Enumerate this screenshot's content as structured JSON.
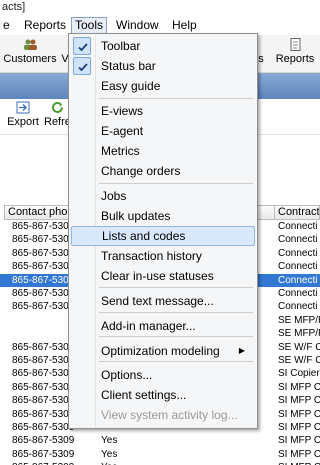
{
  "window": {
    "title_fragment": "acts]"
  },
  "menubar": {
    "items": [
      "e",
      "Reports",
      "Tools",
      "Window",
      "Help"
    ]
  },
  "toolbar": {
    "customers_label": "Customers",
    "cut_label": "V",
    "s_label": "s",
    "reports_label": "Reports",
    "export_label": "Export",
    "refresh_label": "Refre"
  },
  "tools_menu": {
    "items": [
      {
        "label": "Toolbar",
        "checked": true,
        "disabled": false,
        "submenu": false,
        "highlighted": false
      },
      {
        "label": "Status bar",
        "checked": true,
        "disabled": false,
        "submenu": false,
        "highlighted": false
      },
      {
        "label": "Easy guide",
        "checked": false,
        "disabled": false,
        "submenu": false,
        "highlighted": false
      },
      {
        "label": "E-views",
        "checked": false,
        "disabled": false,
        "submenu": false,
        "highlighted": false
      },
      {
        "label": "E-agent",
        "checked": false,
        "disabled": false,
        "submenu": false,
        "highlighted": false
      },
      {
        "label": "Metrics",
        "checked": false,
        "disabled": false,
        "submenu": false,
        "highlighted": false
      },
      {
        "label": "Change orders",
        "checked": false,
        "disabled": false,
        "submenu": false,
        "highlighted": false
      },
      {
        "label": "Jobs",
        "checked": false,
        "disabled": false,
        "submenu": false,
        "highlighted": false
      },
      {
        "label": "Bulk updates",
        "checked": false,
        "disabled": false,
        "submenu": false,
        "highlighted": false
      },
      {
        "label": "Lists and codes",
        "checked": false,
        "disabled": false,
        "submenu": false,
        "highlighted": true
      },
      {
        "label": "Transaction history",
        "checked": false,
        "disabled": false,
        "submenu": false,
        "highlighted": false
      },
      {
        "label": "Clear in-use statuses",
        "checked": false,
        "disabled": false,
        "submenu": false,
        "highlighted": false
      },
      {
        "label": "Send text message...",
        "checked": false,
        "disabled": false,
        "submenu": false,
        "highlighted": false
      },
      {
        "label": "Add-in manager...",
        "checked": false,
        "disabled": false,
        "submenu": false,
        "highlighted": false
      },
      {
        "label": "Optimization modeling",
        "checked": false,
        "disabled": false,
        "submenu": true,
        "highlighted": false
      },
      {
        "label": "Options...",
        "checked": false,
        "disabled": false,
        "submenu": false,
        "highlighted": false
      },
      {
        "label": "Client settings...",
        "checked": false,
        "disabled": false,
        "submenu": false,
        "highlighted": false
      },
      {
        "label": "View system activity log...",
        "checked": false,
        "disabled": true,
        "submenu": false,
        "highlighted": false
      }
    ]
  },
  "grid": {
    "columns": [
      "Contact phone",
      "Contract"
    ],
    "rows": [
      {
        "phone": "865-867-5309",
        "mid": "",
        "contract": "Connecti"
      },
      {
        "phone": "865-867-5309",
        "mid": "",
        "contract": "Connecti"
      },
      {
        "phone": "865-867-5309",
        "mid": "",
        "contract": "Connecti"
      },
      {
        "phone": "865-867-5309",
        "mid": "",
        "contract": "Connecti"
      },
      {
        "phone": "865-867-5309",
        "mid": "",
        "contract": "Connecti"
      },
      {
        "phone": "865-867-5309",
        "mid": "",
        "contract": "Connecti"
      },
      {
        "phone": "865-867-5309",
        "mid": "",
        "contract": "Connecti"
      },
      {
        "phone": "",
        "mid": "",
        "contract": "SE MFP/R"
      },
      {
        "phone": "",
        "mid": "",
        "contract": "SE MFP/R"
      },
      {
        "phone": "865-867-5309",
        "mid": "",
        "contract": "SE W/F C"
      },
      {
        "phone": "865-867-5309",
        "mid": "",
        "contract": "SE W/F C"
      },
      {
        "phone": "865-867-5309",
        "mid": "",
        "contract": "SI Copier"
      },
      {
        "phone": "865-867-5309",
        "mid": "",
        "contract": "SI MFP C"
      },
      {
        "phone": "865-867-5309",
        "mid": "",
        "contract": "SI MFP C"
      },
      {
        "phone": "865-867-5309",
        "mid": "",
        "contract": "SI MFP C"
      },
      {
        "phone": "865-867-5309",
        "mid": "",
        "contract": "SI MFP C"
      },
      {
        "phone": "865-867-5309",
        "mid": "Yes",
        "contract": "SI MFP C"
      },
      {
        "phone": "865-867-5309",
        "mid": "Yes",
        "contract": "SI MFP C"
      },
      {
        "phone": "865-867-5309",
        "mid": "Yes",
        "contract": "SI MFP C"
      }
    ]
  },
  "colors": {
    "selection": "#3278d2",
    "menu_highlight": "#d9e8fb",
    "strip": "#6f93c8"
  }
}
